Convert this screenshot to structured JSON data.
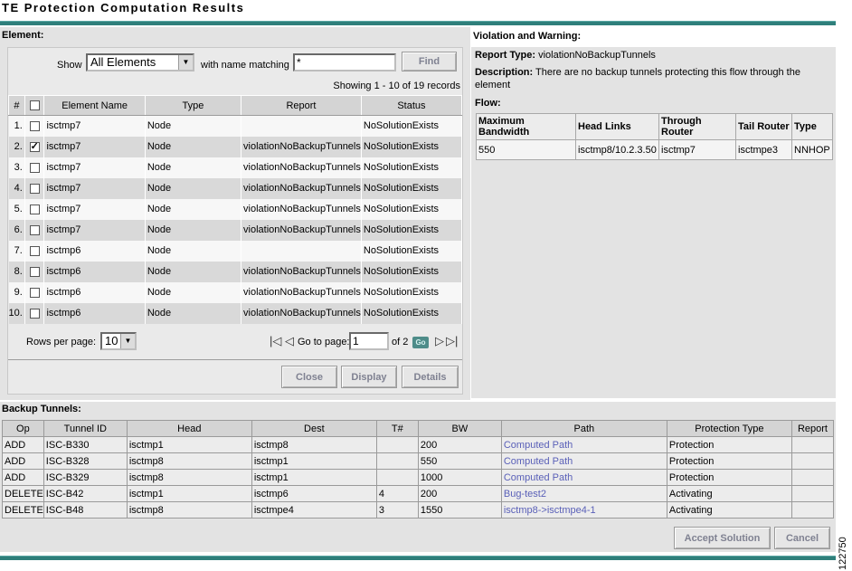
{
  "title": "TE Protection Computation Results",
  "element_section": {
    "label": "Element:",
    "show_label": "Show",
    "show_value": "All Elements",
    "match_label": "with name matching",
    "match_value": "*",
    "find_label": "Find",
    "records_text": "Showing 1 - 10 of 19 records",
    "columns": [
      "#",
      "",
      "Element Name",
      "Type",
      "Report",
      "Status"
    ],
    "rows": [
      {
        "num": "1.",
        "checked": false,
        "name": "isctmp7",
        "type": "Node",
        "report": "",
        "status": "NoSolutionExists"
      },
      {
        "num": "2.",
        "checked": true,
        "name": "isctmp7",
        "type": "Node",
        "report": "violationNoBackupTunnels",
        "status": "NoSolutionExists"
      },
      {
        "num": "3.",
        "checked": false,
        "name": "isctmp7",
        "type": "Node",
        "report": "violationNoBackupTunnels",
        "status": "NoSolutionExists"
      },
      {
        "num": "4.",
        "checked": false,
        "name": "isctmp7",
        "type": "Node",
        "report": "violationNoBackupTunnels",
        "status": "NoSolutionExists"
      },
      {
        "num": "5.",
        "checked": false,
        "name": "isctmp7",
        "type": "Node",
        "report": "violationNoBackupTunnels",
        "status": "NoSolutionExists"
      },
      {
        "num": "6.",
        "checked": false,
        "name": "isctmp7",
        "type": "Node",
        "report": "violationNoBackupTunnels",
        "status": "NoSolutionExists"
      },
      {
        "num": "7.",
        "checked": false,
        "name": "isctmp6",
        "type": "Node",
        "report": "",
        "status": "NoSolutionExists"
      },
      {
        "num": "8.",
        "checked": false,
        "name": "isctmp6",
        "type": "Node",
        "report": "violationNoBackupTunnels",
        "status": "NoSolutionExists"
      },
      {
        "num": "9.",
        "checked": false,
        "name": "isctmp6",
        "type": "Node",
        "report": "violationNoBackupTunnels",
        "status": "NoSolutionExists"
      },
      {
        "num": "10.",
        "checked": false,
        "name": "isctmp6",
        "type": "Node",
        "report": "violationNoBackupTunnels",
        "status": "NoSolutionExists"
      }
    ],
    "rows_per_page_label": "Rows per page:",
    "rows_per_page_value": "10",
    "go_to_page_label": "Go to page:",
    "page_value": "1",
    "of_pages": "of 2",
    "go_label": "Go",
    "buttons": {
      "close": "Close",
      "display": "Display",
      "details": "Details"
    }
  },
  "violation_section": {
    "label": "Violation and Warning:",
    "report_type_label": "Report Type:",
    "report_type_value": "violationNoBackupTunnels",
    "description_label": "Description:",
    "description_value": "There are no backup tunnels protecting this flow through the element",
    "flow_label": "Flow:",
    "flow_columns": [
      "Maximum Bandwidth",
      "Head Links",
      "Through Router",
      "Tail Router",
      "Type"
    ],
    "flow_row": [
      "550",
      "isctmp8/10.2.3.50",
      "isctmp7",
      "isctmpe3",
      "NNHOP"
    ]
  },
  "backup_section": {
    "label": "Backup Tunnels:",
    "columns": [
      "Op",
      "Tunnel ID",
      "Head",
      "Dest",
      "T#",
      "BW",
      "Path",
      "Protection Type",
      "Report"
    ],
    "rows": [
      [
        "ADD",
        "ISC-B330",
        "isctmp1",
        "isctmp8",
        "",
        "200",
        "Computed Path",
        "Protection",
        ""
      ],
      [
        "ADD",
        "ISC-B328",
        "isctmp8",
        "isctmp1",
        "",
        "550",
        "Computed Path",
        "Protection",
        ""
      ],
      [
        "ADD",
        "ISC-B329",
        "isctmp8",
        "isctmp1",
        "",
        "1000",
        "Computed Path",
        "Protection",
        ""
      ],
      [
        "DELETE",
        "ISC-B42",
        "isctmp1",
        "isctmp6",
        "4",
        "200",
        "Bug-test2",
        "Activating",
        ""
      ],
      [
        "DELETE",
        "ISC-B48",
        "isctmp8",
        "isctmpe4",
        "3",
        "1550",
        "isctmp8->isctmpe4-1",
        "Activating",
        ""
      ]
    ],
    "accept_label": "Accept Solution",
    "cancel_label": "Cancel"
  },
  "figure_number": "122750",
  "colors": {
    "teal": "#2f7f7b",
    "link": "#5a60b8",
    "button_text": "#7f8191"
  }
}
